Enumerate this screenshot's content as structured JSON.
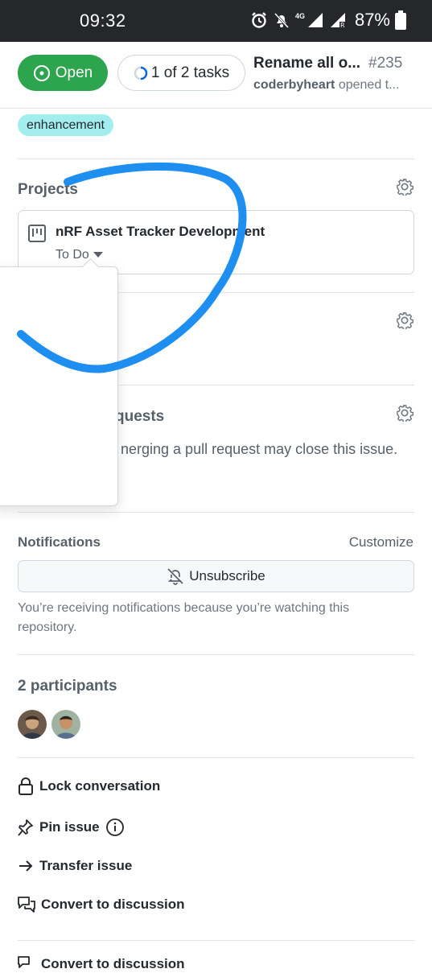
{
  "status_bar": {
    "time": "09:32",
    "network": "4G",
    "battery": "87%"
  },
  "header": {
    "state_label": "Open",
    "tasks_label": "1 of 2 tasks",
    "title": "Rename all o...",
    "number": "#235",
    "author": "coderbyheart",
    "subtitle": "opened t..."
  },
  "labels": [
    "enhancement"
  ],
  "projects": {
    "heading": "Projects",
    "card": {
      "name": "nRF Asset Tracker Development",
      "status": "To Do"
    }
  },
  "linked_prs": {
    "heading_visible": "quests",
    "description_visible": "nerging a pull request may close this issue."
  },
  "notifications": {
    "heading": "Notifications",
    "customize": "Customize",
    "button": "Unsubscribe",
    "note": "You’re receiving notifications because you’re watching this repository."
  },
  "participants": {
    "heading": "2 participants"
  },
  "actions": [
    {
      "label": "Lock conversation",
      "icon": "lock-icon"
    },
    {
      "label": "Pin issue",
      "icon": "pin-icon"
    },
    {
      "label": "Transfer issue",
      "icon": "arrow-right-icon"
    },
    {
      "label": "Convert to discussion",
      "icon": "discussion-icon"
    },
    {
      "label": "Convert to discussion",
      "icon": "discussion-icon"
    }
  ],
  "colors": {
    "open": "#2da44e",
    "label_bg": "#a2eeef",
    "scribble": "#1e8ff0",
    "statusbar": "#25272b"
  }
}
